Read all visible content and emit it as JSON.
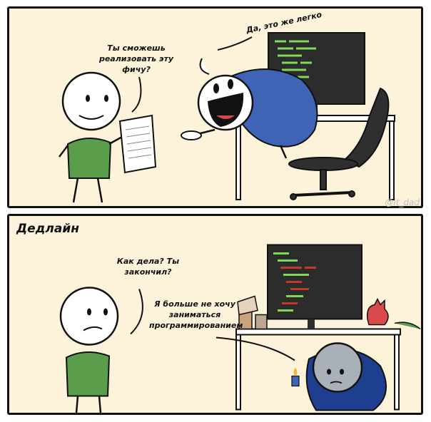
{
  "panel1": {
    "question_bubble": "Ты сможешь реализовать эту фичу?",
    "answer_bubble": "Да, это же легко"
  },
  "panel2": {
    "title": "Дедлайн",
    "question_bubble": "Как дела? Ты закончил?",
    "answer_bubble": "Я больше не хочу заниматься программированием"
  },
  "watermark": "@it_dad",
  "colors": {
    "panel_bg": "#fdf3da",
    "shirt_green": "#5a9e4b",
    "hoodie_blue": "#3f63b5",
    "sad_hoodie_blue": "#1e3f8f",
    "monitor": "#2c2c2c",
    "code_green": "#7ed957",
    "code_red": "#c0392b"
  }
}
